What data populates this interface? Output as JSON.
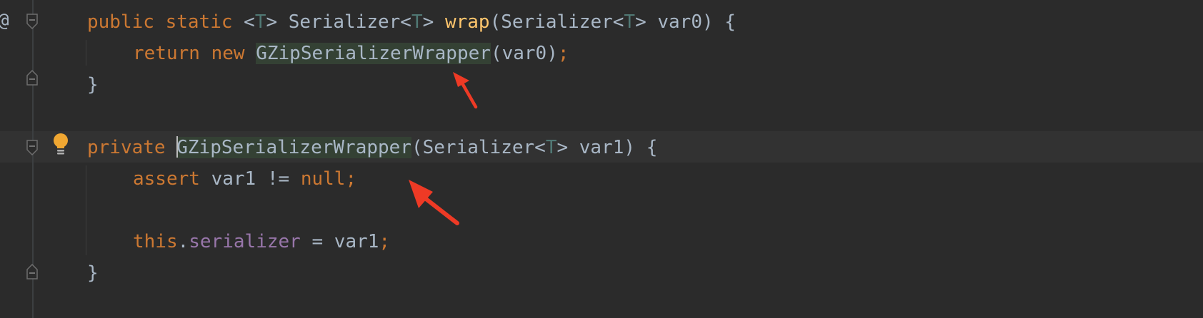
{
  "editor": {
    "gutter": {
      "override_marker": "@"
    },
    "lines": [
      {
        "tokens": [
          {
            "text": "public",
            "style": "kw"
          },
          {
            "text": " ",
            "style": "plain"
          },
          {
            "text": "static",
            "style": "kw"
          },
          {
            "text": " <",
            "style": "plain"
          },
          {
            "text": "T",
            "style": "gen"
          },
          {
            "text": "> Serializer<",
            "style": "plain"
          },
          {
            "text": "T",
            "style": "gen"
          },
          {
            "text": "> ",
            "style": "plain"
          },
          {
            "text": "wrap",
            "style": "fn"
          },
          {
            "text": "(Serializer<",
            "style": "plain"
          },
          {
            "text": "T",
            "style": "gen"
          },
          {
            "text": "> var0) {",
            "style": "plain"
          }
        ]
      },
      {
        "tokens": [
          {
            "text": "return",
            "style": "kw"
          },
          {
            "text": " ",
            "style": "plain"
          },
          {
            "text": "new",
            "style": "kw"
          },
          {
            "text": " ",
            "style": "plain"
          },
          {
            "text": "GZipSerializerWrapper",
            "style": "hl"
          },
          {
            "text": "(var0)",
            "style": "plain"
          },
          {
            "text": ";",
            "style": "kw"
          }
        ]
      },
      {
        "tokens": [
          {
            "text": "}",
            "style": "plain"
          }
        ]
      },
      {
        "tokens": []
      },
      {
        "tokens": [
          {
            "text": "private",
            "style": "kw"
          },
          {
            "text": " ",
            "style": "plain"
          },
          {
            "text": "GZipSerializerWrapper",
            "style": "hl-caret"
          },
          {
            "text": "(Serializer<",
            "style": "plain"
          },
          {
            "text": "T",
            "style": "gen"
          },
          {
            "text": "> var1) {",
            "style": "plain"
          }
        ]
      },
      {
        "tokens": [
          {
            "text": "assert",
            "style": "kw"
          },
          {
            "text": " var1 != ",
            "style": "plain"
          },
          {
            "text": "null",
            "style": "kw"
          },
          {
            "text": ";",
            "style": "kw"
          }
        ]
      },
      {
        "tokens": []
      },
      {
        "tokens": [
          {
            "text": "this",
            "style": "kw"
          },
          {
            "text": ".",
            "style": "plain"
          },
          {
            "text": "serializer",
            "style": "fld"
          },
          {
            "text": " = var1",
            "style": "plain"
          },
          {
            "text": ";",
            "style": "kw"
          }
        ]
      },
      {
        "tokens": [
          {
            "text": "}",
            "style": "plain"
          }
        ]
      }
    ]
  },
  "colors": {
    "background": "#2b2b2b",
    "caret_row": "#323232",
    "keyword": "#cc7832",
    "identifier": "#a9b7c6",
    "type_parameter": "#507874",
    "method_declaration": "#ffc66d",
    "field": "#9876aa",
    "usage_highlight": "#344134",
    "annotation_arrow": "#ee3a25",
    "intention_bulb": "#f0a732"
  },
  "icons": {
    "fold_markers": "fold-marker-icon",
    "intention": "lightbulb-icon",
    "annotation": "red-arrow"
  }
}
